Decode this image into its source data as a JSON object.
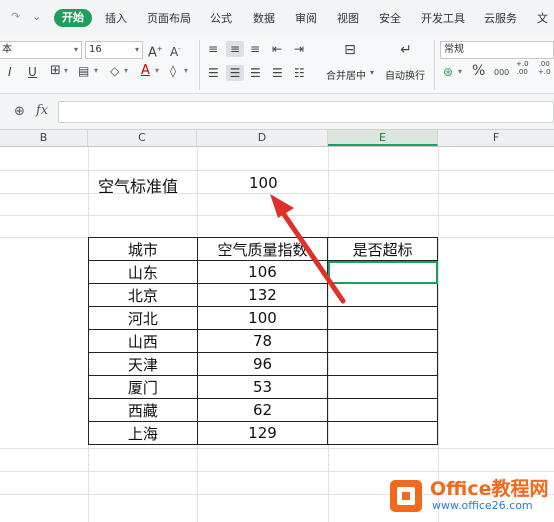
{
  "menu": {
    "start": "开始",
    "items": [
      "插入",
      "页面布局",
      "公式",
      "数据",
      "审阅",
      "视图",
      "安全",
      "开发工具",
      "云服务",
      "文"
    ]
  },
  "ribbon": {
    "font_name": "本",
    "font_size": "16",
    "number_format": "常规",
    "merge_label": "合并居中",
    "wrap_label": "自动换行",
    "percent": "%",
    "dec_up": "000",
    "dec_inc": "+.0\n.00",
    "dec_dec": ".00\n+.0"
  },
  "formula_bar": {
    "fx": "fx",
    "value": ""
  },
  "columns": [
    "B",
    "C",
    "D",
    "E",
    "F"
  ],
  "sheet": {
    "label_cell": "空气标准值",
    "standard_value": "100",
    "table": {
      "headers": [
        "城市",
        "空气质量指数",
        "是否超标"
      ],
      "rows": [
        [
          "山东",
          "106",
          ""
        ],
        [
          "北京",
          "132",
          ""
        ],
        [
          "河北",
          "100",
          ""
        ],
        [
          "山西",
          "78",
          ""
        ],
        [
          "天津",
          "96",
          ""
        ],
        [
          "厦门",
          "53",
          ""
        ],
        [
          "西藏",
          "62",
          ""
        ],
        [
          "上海",
          "129",
          ""
        ]
      ]
    }
  },
  "watermark": {
    "brand": "Office教程网",
    "url": "www.office26.com"
  },
  "colors": {
    "accent_green": "#1e9f5d",
    "arrow_red": "#e0302a",
    "brand_orange": "#f06a1d",
    "brand_blue": "#2a7bd3"
  }
}
